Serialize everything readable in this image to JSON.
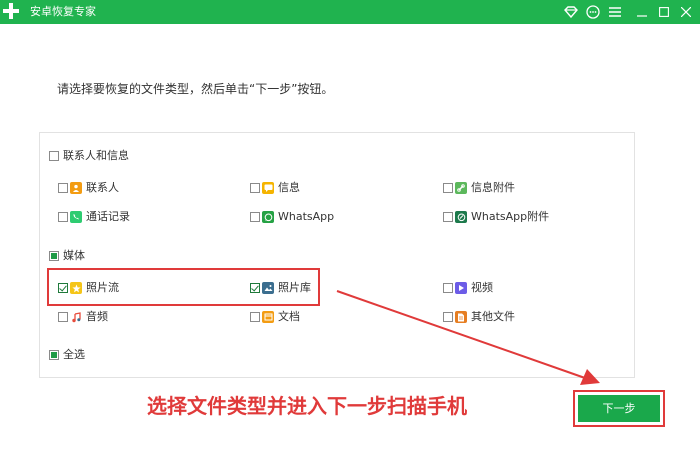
{
  "app": {
    "title": "安卓恢复专家"
  },
  "instruction": "请选择要恢复的文件类型，然后单击“下一步”按钮。",
  "groups": {
    "contacts": {
      "label": "联系人和信息",
      "items": [
        {
          "label": "联系人",
          "icon": "contact-icon",
          "color": "#f39c12"
        },
        {
          "label": "信息",
          "icon": "message-icon",
          "color": "#f5b400"
        },
        {
          "label": "信息附件",
          "icon": "attachment-icon",
          "color": "#5cb85c"
        },
        {
          "label": "通话记录",
          "icon": "call-log-icon",
          "color": "#2ecc71"
        },
        {
          "label": "WhatsApp",
          "icon": "whatsapp-icon",
          "color": "#25a244"
        },
        {
          "label": "WhatsApp附件",
          "icon": "whatsapp-attachment-icon",
          "color": "#1d7a4c"
        }
      ]
    },
    "media": {
      "label": "媒体",
      "items": [
        {
          "label": "照片流",
          "icon": "photo-stream-icon",
          "color": "#f5c518",
          "checked": true
        },
        {
          "label": "照片库",
          "icon": "photo-library-icon",
          "color": "#3b6e8f",
          "checked": true
        },
        {
          "label": "视频",
          "icon": "video-icon",
          "color": "#6c5ce7"
        },
        {
          "label": "音频",
          "icon": "audio-icon",
          "color": "#e74c3c"
        },
        {
          "label": "文档",
          "icon": "document-icon",
          "color": "#f39c12"
        },
        {
          "label": "其他文件",
          "icon": "other-files-icon",
          "color": "#e67e22"
        }
      ]
    },
    "select_all": {
      "label": "全选"
    }
  },
  "annotation": "选择文件类型并进入下一步扫描手机",
  "next_button": "下一步",
  "colors": {
    "brand": "#20b34f",
    "highlight": "#e03a3a",
    "button": "#1aa84b"
  }
}
